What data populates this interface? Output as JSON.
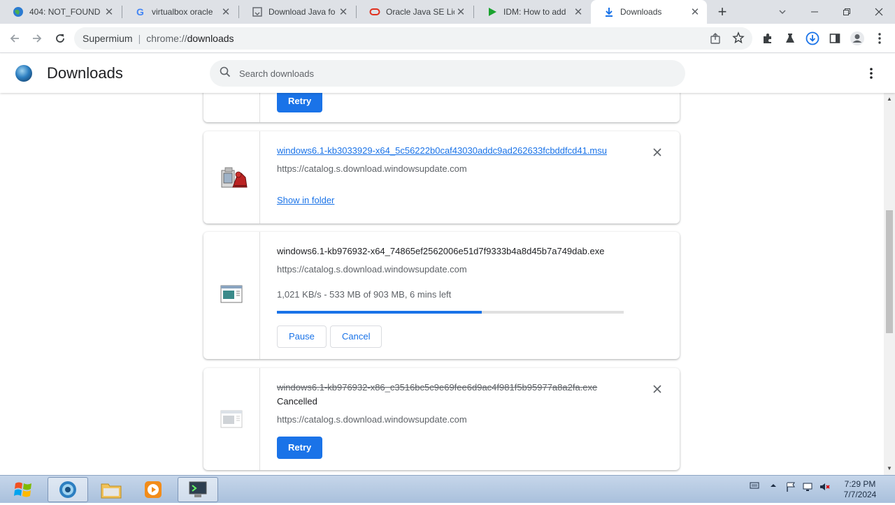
{
  "browser": {
    "tabs": [
      {
        "title": "404: NOT_FOUND",
        "icon": "vercel-globe-icon",
        "active": false
      },
      {
        "title": "virtualbox oracle",
        "icon": "google-icon",
        "active": false
      },
      {
        "title": "Download Java fo",
        "icon": "java-icon",
        "active": false
      },
      {
        "title": "Oracle Java SE Lice",
        "icon": "oracle-icon",
        "active": false
      },
      {
        "title": "IDM: How to add",
        "icon": "idm-icon",
        "active": false
      },
      {
        "title": "Downloads",
        "icon": "download-icon",
        "active": true
      }
    ],
    "new_tab_label": "+",
    "omnibox": {
      "site": "Supermium",
      "url_prefix": "chrome://",
      "url_path": "downloads"
    }
  },
  "page": {
    "title": "Downloads",
    "search_placeholder": "Search downloads"
  },
  "downloads": [
    {
      "retry_label": "Retry"
    },
    {
      "filename": "windows6.1-kb3033929-x64_5c56222b0caf43030addc9ad262633fcbddfcd41.msu",
      "url": "https://catalog.s.download.windowsupdate.com",
      "action_label": "Show in folder"
    },
    {
      "filename": "windows6.1-kb976932-x64_74865ef2562006e51d7f9333b4a8d45b7a749dab.exe",
      "url": "https://catalog.s.download.windowsupdate.com",
      "status": "1,021 KB/s - 533 MB of 903 MB, 6 mins left",
      "progress_percent": 59,
      "pause_label": "Pause",
      "cancel_label": "Cancel"
    },
    {
      "filename": "windows6.1-kb976932-x86_c3516bc5c9e69fee6d9ac4f981f5b95977a8a2fa.exe",
      "status": "Cancelled",
      "url": "https://catalog.s.download.windowsupdate.com",
      "retry_label": "Retry"
    }
  ],
  "taskbar": {
    "clock_time": "7:29 PM",
    "clock_date": "7/7/2024"
  },
  "colors": {
    "accent": "#1a73e8",
    "tabstrip": "#dee1e6",
    "taskbar": "#b8cbe3"
  }
}
